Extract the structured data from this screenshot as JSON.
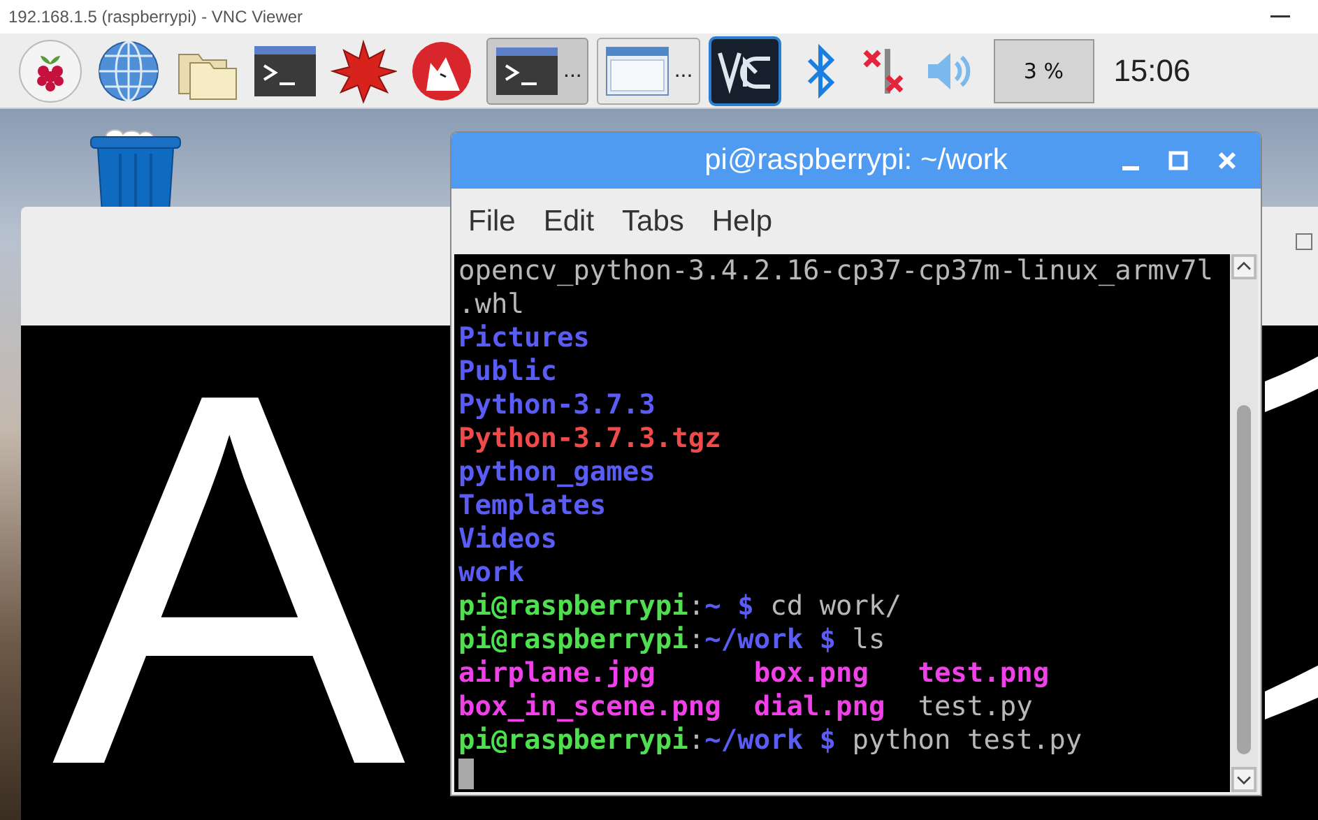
{
  "viewer": {
    "title": "192.168.1.5 (raspberrypi) - VNC Viewer"
  },
  "taskbar": {
    "tasks": [
      {
        "label": "...",
        "kind": "terminal",
        "selected": true
      },
      {
        "label": "...",
        "kind": "window",
        "selected": false
      }
    ],
    "cpu": "3 %",
    "clock": "15:06"
  },
  "image_window": {
    "image_text": "A"
  },
  "terminal": {
    "title": "pi@raspberrypi: ~/work",
    "menu": [
      "File",
      "Edit",
      "Tabs",
      "Help"
    ],
    "lines": [
      {
        "kind": "text",
        "segments": [
          {
            "kind": "plain",
            "text": "opencv_python-3.4.2.16-cp37-cp37m-linux_armv7l"
          }
        ]
      },
      {
        "kind": "text",
        "segments": [
          {
            "kind": "plain",
            "text": ".whl"
          }
        ]
      },
      {
        "kind": "text",
        "segments": [
          {
            "kind": "dir",
            "text": "Pictures"
          }
        ]
      },
      {
        "kind": "text",
        "segments": [
          {
            "kind": "dir",
            "text": "Public"
          }
        ]
      },
      {
        "kind": "text",
        "segments": [
          {
            "kind": "dir",
            "text": "Python-3.7.3"
          }
        ]
      },
      {
        "kind": "text",
        "segments": [
          {
            "kind": "archive",
            "text": "Python-3.7.3.tgz"
          }
        ]
      },
      {
        "kind": "text",
        "segments": [
          {
            "kind": "dir",
            "text": "python_games"
          }
        ]
      },
      {
        "kind": "text",
        "segments": [
          {
            "kind": "dir",
            "text": "Templates"
          }
        ]
      },
      {
        "kind": "text",
        "segments": [
          {
            "kind": "dir",
            "text": "Videos"
          }
        ]
      },
      {
        "kind": "text",
        "segments": [
          {
            "kind": "dir",
            "text": "work"
          }
        ]
      },
      {
        "kind": "text",
        "segments": [
          {
            "kind": "user",
            "text": "pi@raspberrypi"
          },
          {
            "kind": "sep",
            "text": ":"
          },
          {
            "kind": "path",
            "text": "~ $"
          },
          {
            "kind": "command",
            "text": "cd work/"
          }
        ]
      },
      {
        "kind": "text",
        "segments": [
          {
            "kind": "user",
            "text": "pi@raspberrypi"
          },
          {
            "kind": "sep",
            "text": ":"
          },
          {
            "kind": "path",
            "text": "~/work $"
          },
          {
            "kind": "command",
            "text": "ls"
          }
        ]
      },
      {
        "kind": "files",
        "items": [
          {
            "kind": "image",
            "text": "airplane.jpg"
          },
          {
            "kind": "image",
            "text": "box.png"
          },
          {
            "kind": "image",
            "text": "test.png"
          }
        ]
      },
      {
        "kind": "files",
        "items": [
          {
            "kind": "image",
            "text": "box_in_scene.png"
          },
          {
            "kind": "image",
            "text": "dial.png"
          },
          {
            "kind": "plain",
            "text": "test.py"
          }
        ]
      },
      {
        "kind": "text",
        "segments": [
          {
            "kind": "user",
            "text": "pi@raspberrypi"
          },
          {
            "kind": "sep",
            "text": ":"
          },
          {
            "kind": "path",
            "text": "~/work $"
          },
          {
            "kind": "command",
            "text": "python test.py"
          }
        ]
      },
      {
        "kind": "cursor"
      }
    ]
  }
}
